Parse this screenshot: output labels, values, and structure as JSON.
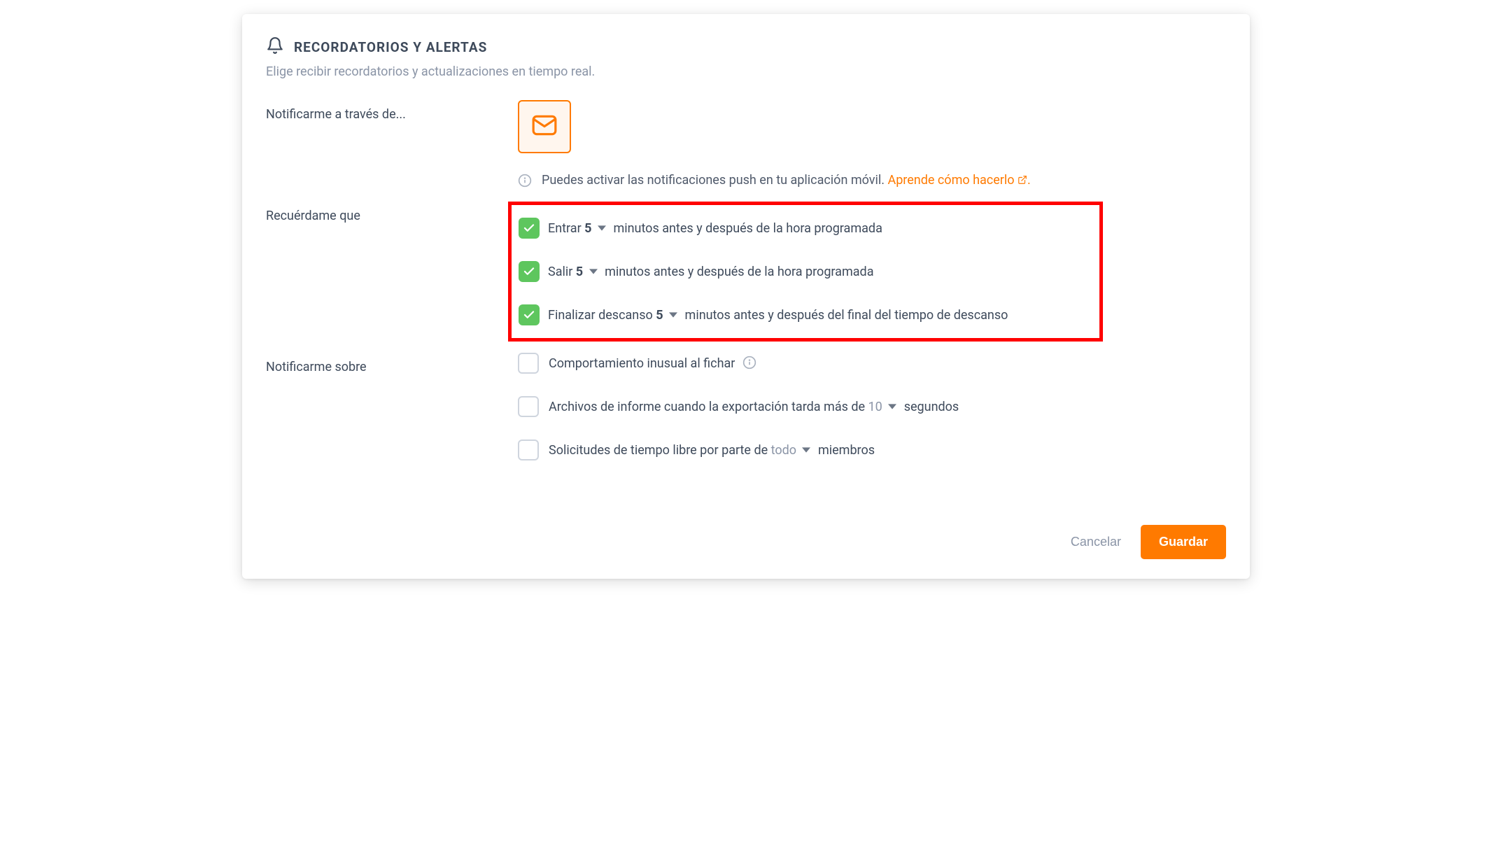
{
  "header": {
    "title": "RECORDATORIOS Y ALERTAS",
    "subtitle": "Elige recibir recordatorios y actualizaciones en tiempo real."
  },
  "notify_via": {
    "label": "Notificarme a través de...",
    "info_text": "Puedes activar las notificaciones push en tu aplicación móvil. ",
    "link_text": "Aprende cómo hacerlo "
  },
  "remind": {
    "label": "Recuérdame que",
    "rows": [
      {
        "checked": true,
        "prefix": "Entrar ",
        "value": "5",
        "suffix": "minutos antes y después de la hora programada"
      },
      {
        "checked": true,
        "prefix": "Salir ",
        "value": "5",
        "suffix": "minutos antes y después de la hora programada"
      },
      {
        "checked": true,
        "prefix": "Finalizar descanso ",
        "value": "5",
        "suffix": "minutos antes y después del final del tiempo de descanso"
      }
    ]
  },
  "notify_about": {
    "label": "Notificarme sobre",
    "rows": [
      {
        "checked": false,
        "text": "Comportamiento inusual al fichar",
        "has_info": true
      },
      {
        "checked": false,
        "prefix": "Archivos de informe cuando la exportación tarda más de ",
        "value": "10",
        "suffix": "segundos"
      },
      {
        "checked": false,
        "prefix": "Solicitudes de tiempo libre por parte de ",
        "value": "todo",
        "suffix": "miembros"
      }
    ]
  },
  "footer": {
    "cancel": "Cancelar",
    "save": "Guardar"
  }
}
